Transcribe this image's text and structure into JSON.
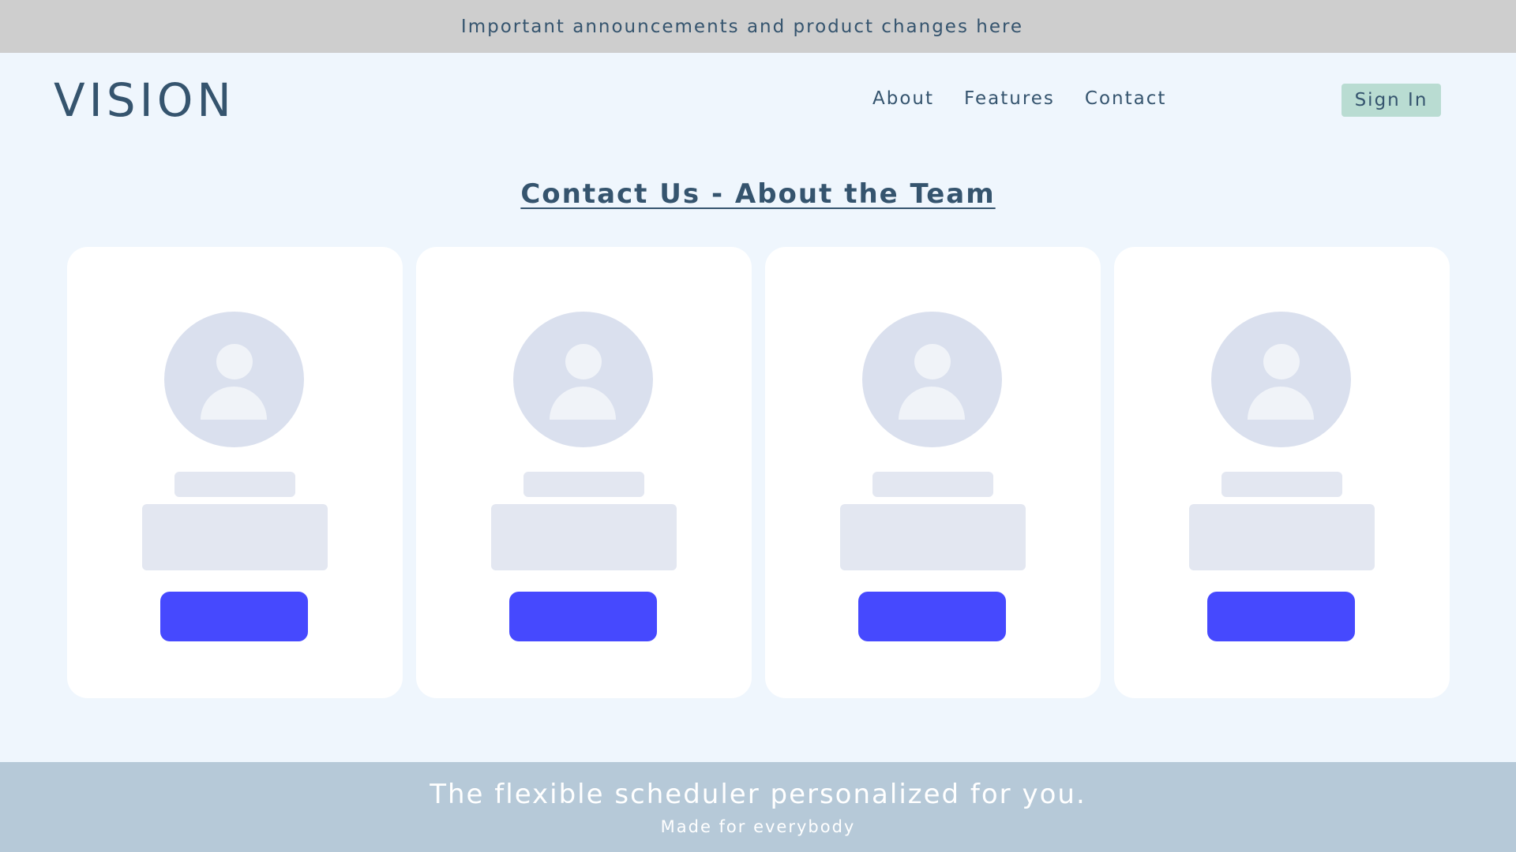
{
  "announcement": {
    "text": "Important announcements and product changes here"
  },
  "header": {
    "logo": "VISION",
    "nav": [
      {
        "label": "About"
      },
      {
        "label": "Features"
      },
      {
        "label": "Contact"
      }
    ],
    "sign_in_label": "Sign In"
  },
  "main": {
    "title": "Contact Us - About the Team",
    "cards": [
      {
        "avatar_icon": "user-avatar-icon"
      },
      {
        "avatar_icon": "user-avatar-icon"
      },
      {
        "avatar_icon": "user-avatar-icon"
      },
      {
        "avatar_icon": "user-avatar-icon"
      }
    ]
  },
  "footer": {
    "tagline": "The flexible scheduler personalized for you.",
    "subtitle": "Made for everybody"
  },
  "colors": {
    "page_bg": "#eff6fd",
    "announcement_bg": "#cecece",
    "text": "#35546e",
    "sign_in_bg": "#b9dcd2",
    "card_bg": "#ffffff",
    "avatar_bg": "#dae0ee",
    "placeholder": "#e3e7f1",
    "button": "#4649fe",
    "footer_bg": "#b6c9d8"
  }
}
